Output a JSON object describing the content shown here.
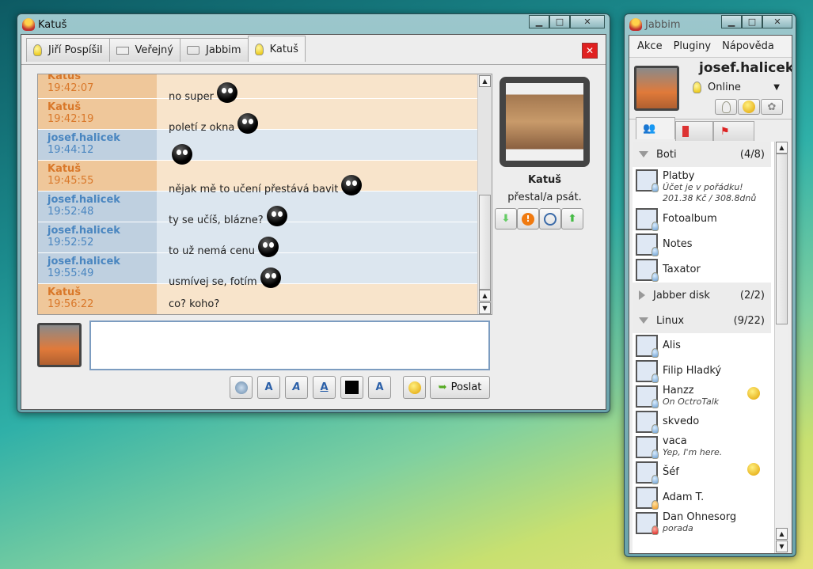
{
  "chat_window": {
    "title": "Katuš",
    "tabs": [
      {
        "label": "Jiří Pospíšil",
        "icon": "bulb-icon"
      },
      {
        "label": "Veřejný",
        "icon": "drive-icon"
      },
      {
        "label": "Jabbim",
        "icon": "chat-icon"
      },
      {
        "label": "Katuš",
        "icon": "bulb-icon",
        "active": true
      }
    ],
    "messages": [
      {
        "from": "Katuš",
        "time": "19:42:07",
        "text": "no super",
        "side": "k"
      },
      {
        "from": "Katuš",
        "time": "19:42:19",
        "text": "poletí z okna",
        "side": "k"
      },
      {
        "from": "josef.halicek",
        "time": "19:44:12",
        "text": "",
        "side": "j"
      },
      {
        "from": "Katuš",
        "time": "19:45:55",
        "text": "nějak mě to učení přestává bavit",
        "side": "k"
      },
      {
        "from": "josef.halicek",
        "time": "19:52:48",
        "text": "ty se učíš, blázne?",
        "side": "j"
      },
      {
        "from": "josef.halicek",
        "time": "19:52:52",
        "text": "to už nemá cenu",
        "side": "j"
      },
      {
        "from": "josef.halicek",
        "time": "19:55:49",
        "text": "usmívej se, fotím",
        "side": "j"
      },
      {
        "from": "Katuš",
        "time": "19:56:22",
        "text": "co? koho?",
        "side": "k"
      }
    ],
    "contact_name": "Katuš",
    "contact_status": "přestal/a psát.",
    "input_value": "",
    "send_label": "Poslat"
  },
  "roster": {
    "title": "Jabbim",
    "menu": [
      "Akce",
      "Pluginy",
      "Nápověda"
    ],
    "username": "josef.halicek",
    "status": "Online",
    "groups": [
      {
        "name": "Boti",
        "count": "(4/8)",
        "contacts": [
          {
            "name": "Platby",
            "status": "Účet je v pořádku!",
            "extra": "201.38 Kč / 308.8dnů"
          },
          {
            "name": "Fotoalbum"
          },
          {
            "name": "Notes"
          },
          {
            "name": "Taxator"
          }
        ]
      },
      {
        "name": "Jabber disk",
        "count": "(2/2)",
        "contacts": []
      },
      {
        "name": "Linux",
        "count": "(9/22)",
        "contacts": [
          {
            "name": "Alis"
          },
          {
            "name": "Filip Hladký"
          },
          {
            "name": "Hanzz",
            "status": "On OctroTalk"
          },
          {
            "name": "skvedo"
          },
          {
            "name": "vaca",
            "status": "Yep, I'm here."
          },
          {
            "name": "Šéf"
          },
          {
            "name": "Adam T."
          },
          {
            "name": "Dan Ohnesorg",
            "status": "porada"
          }
        ]
      }
    ]
  }
}
